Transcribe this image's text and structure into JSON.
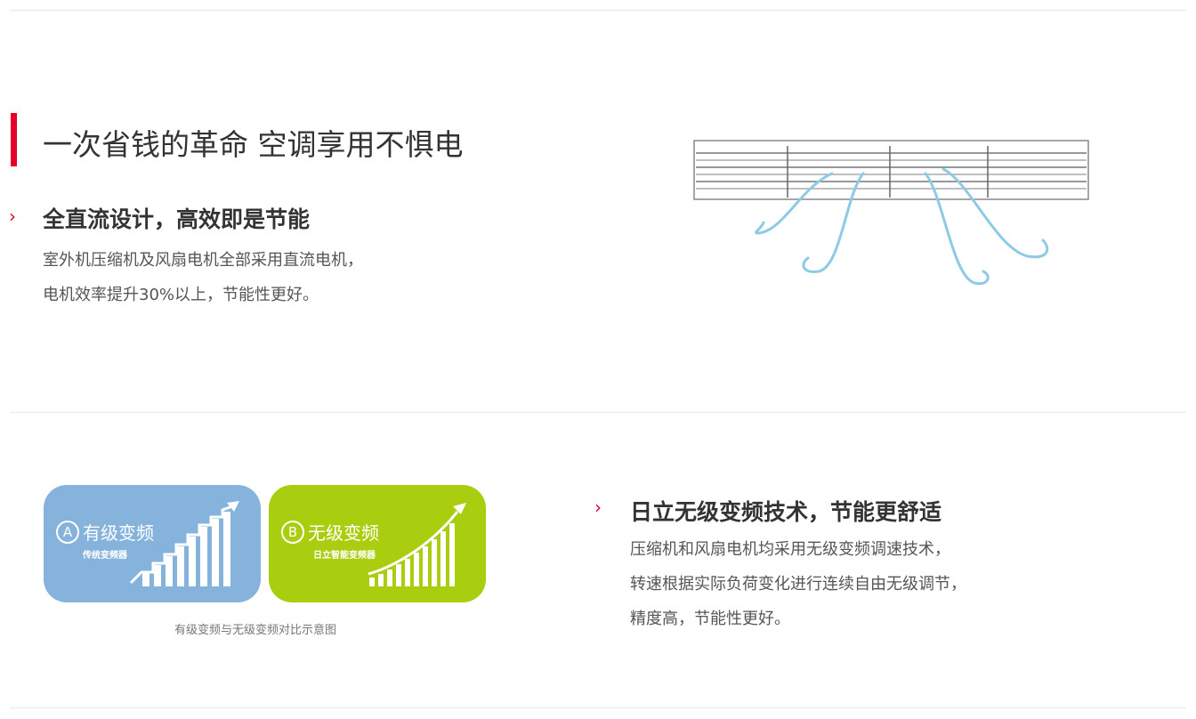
{
  "section1": {
    "headline": "一次省钱的革命  空调享用不惧电",
    "feature": {
      "chevron": "›",
      "title": "全直流设计，高效即是节能",
      "lines": [
        "室外机压缩机及风扇电机全部采用直流电机，",
        "电机效率提升30%以上，节能性更好。"
      ]
    }
  },
  "section2": {
    "card_a": {
      "letter": "A",
      "title": "有级变频",
      "subtitle": "传统变频器",
      "color": "#85b3dc"
    },
    "card_b": {
      "letter": "B",
      "title": "无级变频",
      "subtitle": "日立智能变频器",
      "color": "#a9cd0f"
    },
    "caption": "有级变频与无级变频对比示意图",
    "feature": {
      "chevron": "›",
      "title": "日立无级变频技术，节能更舒适",
      "lines": [
        "压缩机和风扇电机均采用无级变频调速技术，",
        "转速根据实际负荷变化进行连续自由无级调节，",
        "精度高，节能性更好。"
      ]
    }
  },
  "colors": {
    "accent": "#e4002b",
    "text": "#333333",
    "divider": "#e8e8e8",
    "airflow": "#8ecae6"
  }
}
